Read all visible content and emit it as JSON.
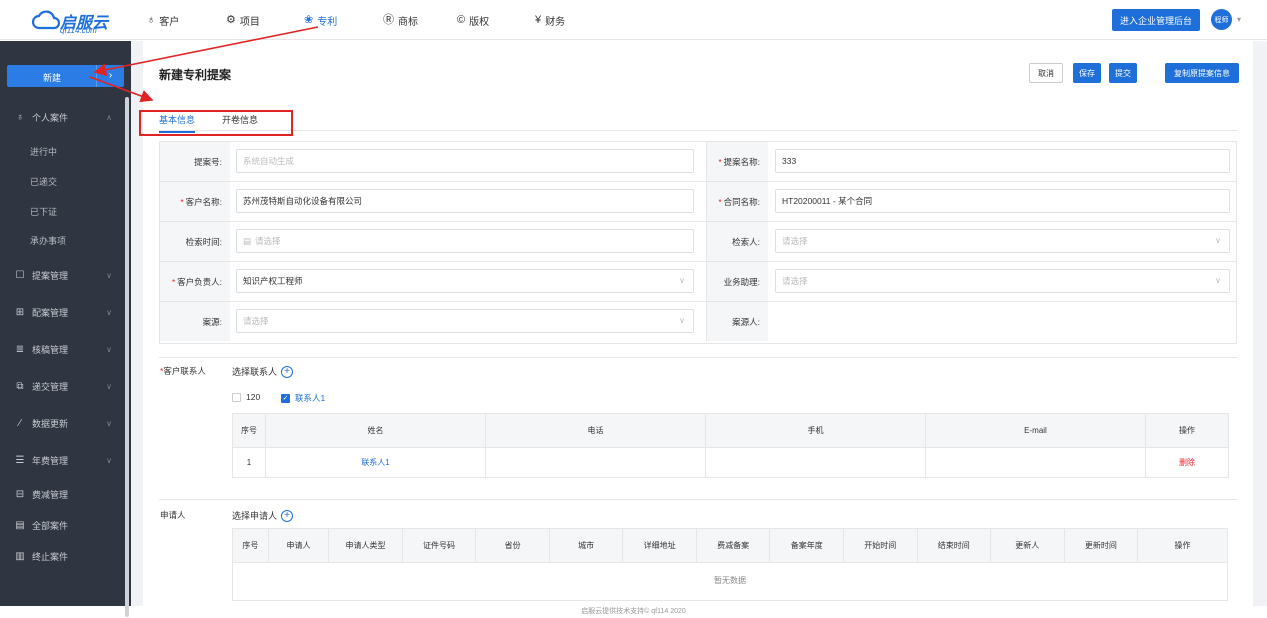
{
  "app": {
    "logo_title": "启服云",
    "logo_sub": "qf114.com"
  },
  "topnav": [
    {
      "label": "客户",
      "icon": "customer-icon"
    },
    {
      "label": "项目",
      "icon": "project-icon"
    },
    {
      "label": "专利",
      "icon": "patent-icon",
      "active": true
    },
    {
      "label": "商标",
      "icon": "trademark-icon"
    },
    {
      "label": "版权",
      "icon": "copyright-icon"
    },
    {
      "label": "财务",
      "icon": "finance-icon"
    }
  ],
  "header": {
    "admin_button": "进入企业管理后台",
    "avatar_text": "程师"
  },
  "sidebar": {
    "new_button": "新建",
    "items": [
      {
        "label": "个人案件",
        "icon": "user-icon",
        "expanded": true
      },
      {
        "label": "进行中"
      },
      {
        "label": "已递交"
      },
      {
        "label": "已下证"
      },
      {
        "label": "承办事项"
      },
      {
        "label": "提案管理",
        "icon": "proposal-icon"
      },
      {
        "label": "配案管理",
        "icon": "assign-icon"
      },
      {
        "label": "核稿管理",
        "icon": "review-icon"
      },
      {
        "label": "递交管理",
        "icon": "submit-icon"
      },
      {
        "label": "数据更新",
        "icon": "data-icon"
      },
      {
        "label": "年费管理",
        "icon": "annual-fee-icon"
      },
      {
        "label": "费减管理",
        "icon": "fee-reduction-icon"
      },
      {
        "label": "全部案件",
        "icon": "all-cases-icon"
      },
      {
        "label": "终止案件",
        "icon": "terminated-icon"
      }
    ]
  },
  "page": {
    "title": "新建专利提案",
    "buttons": {
      "cancel": "取消",
      "save": "保存",
      "submit": "提交",
      "copy": "复制原提案信息"
    },
    "tabs": [
      "基本信息",
      "开卷信息"
    ]
  },
  "form": {
    "proposal_no": {
      "label": "提案号:",
      "placeholder": "系统自动生成"
    },
    "proposal_name": {
      "label": "提案名称:",
      "value": "333"
    },
    "customer_name": {
      "label": "客户名称:",
      "value": "苏州茂特斯自动化设备有限公司"
    },
    "contract_name": {
      "label": "合同名称:",
      "value": "HT20200011 - 某个合同"
    },
    "search_time": {
      "label": "检索时间:",
      "placeholder": "请选择"
    },
    "searcher": {
      "label": "检索人:",
      "placeholder": "请选择"
    },
    "customer_owner": {
      "label": "客户负责人:",
      "value": "知识产权工程师"
    },
    "business_assistant": {
      "label": "业务助理:",
      "placeholder": "请选择"
    },
    "case_source": {
      "label": "案源:",
      "placeholder": "请选择"
    },
    "case_source_person": {
      "label": "案源人:"
    }
  },
  "contacts": {
    "label": "客户联系人",
    "select_label": "选择联系人",
    "options": [
      {
        "label": "120",
        "checked": false
      },
      {
        "label": "联系人1",
        "checked": true
      }
    ],
    "columns": [
      "序号",
      "姓名",
      "电话",
      "手机",
      "E-mail",
      "操作"
    ],
    "rows": [
      {
        "index": "1",
        "name": "联系人1",
        "phone": "",
        "mobile": "",
        "email": "",
        "action": "删除"
      }
    ]
  },
  "applicants": {
    "label": "申请人",
    "select_label": "选择申请人",
    "columns": [
      "序号",
      "申请人",
      "申请人类型",
      "证件号码",
      "省份",
      "城市",
      "详细地址",
      "费减备案",
      "备案年度",
      "开始时间",
      "结束时间",
      "更新人",
      "更新时间",
      "操作"
    ],
    "empty_text": "暂无数据"
  },
  "footer": "启服云提供技术支持© qf114 2020",
  "colors": {
    "brand": "#1e6fd9",
    "sidebar_bg": "#2f3541",
    "danger": "#f5222d",
    "annotation": "#e02424"
  }
}
